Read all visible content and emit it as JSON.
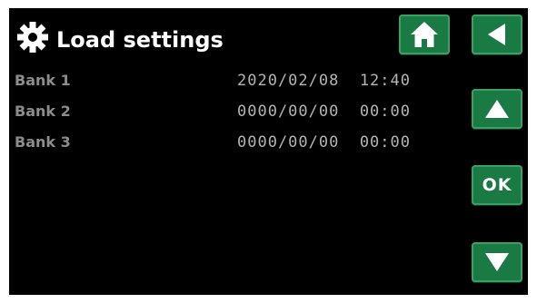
{
  "header": {
    "title": "Load settings",
    "icon": "gear-icon"
  },
  "banks": [
    {
      "label": "Bank 1",
      "datetime": "2020/02/08  12:40"
    },
    {
      "label": "Bank 2",
      "datetime": "0000/00/00  00:00"
    },
    {
      "label": "Bank 3",
      "datetime": "0000/00/00  00:00"
    }
  ],
  "buttons": {
    "home": "home-icon",
    "back": "back-arrow-icon",
    "up": "up-arrow-icon",
    "ok_label": "OK",
    "down": "down-arrow-icon"
  },
  "colors": {
    "background": "#000000",
    "button": "#1a7a44",
    "title": "#ffffff",
    "label": "#8c8c8c",
    "value": "#b4b4b4"
  }
}
